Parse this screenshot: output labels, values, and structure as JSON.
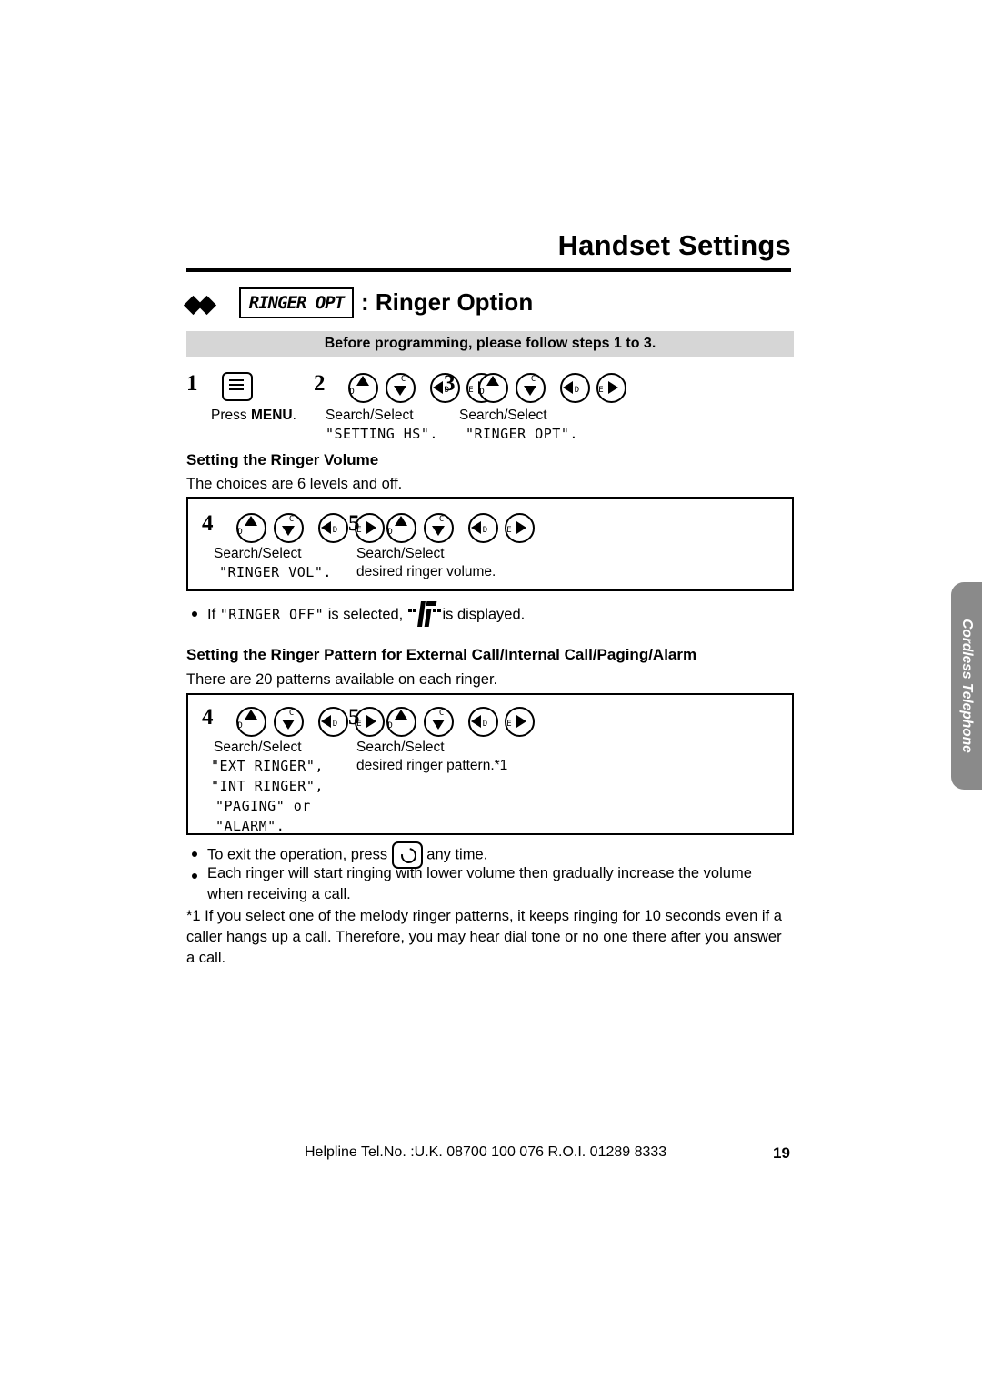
{
  "header": {
    "title": "Handset Settings"
  },
  "section": {
    "lcd_label": "RINGER OPT",
    "title": ": Ringer Option",
    "notice": "Before programming, please follow steps 1 to 3."
  },
  "steps_top": [
    {
      "num": "1",
      "caption": "Press ",
      "caption_bold": "MENU",
      "caption_end": ".",
      "lcd": ""
    },
    {
      "num": "2",
      "caption": "Search/Select",
      "lcd": "\"SETTING HS\"."
    },
    {
      "num": "3",
      "caption": "Search/Select",
      "lcd": "\"RINGER OPT\"."
    }
  ],
  "volume": {
    "heading": "Setting the Ringer Volume",
    "subtext": "The choices are 6 levels and off.",
    "steps": [
      {
        "num": "4",
        "caption": "Search/Select",
        "lcd": "\"RINGER VOL\"."
      },
      {
        "num": "5",
        "caption": "Search/Select",
        "lcd": "desired ringer volume."
      }
    ],
    "note_pre": "If ",
    "note_code": "\"RINGER OFF\"",
    "note_mid": " is selected, ",
    "note_end": " is displayed."
  },
  "pattern": {
    "heading": "Setting the Ringer Pattern for External Call/Internal Call/Paging/Alarm",
    "subtext": "There are 20 patterns available on each ringer.",
    "steps": [
      {
        "num": "4",
        "caption": "Search/Select",
        "lcd_lines": [
          "\"EXT RINGER\",",
          "\"INT RINGER\",",
          "\"PAGING\" or",
          "\"ALARM\"."
        ]
      },
      {
        "num": "5",
        "caption": "Search/Select",
        "lcd_lines": [
          "desired ringer pattern.*1"
        ]
      }
    ]
  },
  "notes": [
    {
      "pre": "To exit the operation, press ",
      "post": " any time."
    },
    {
      "text": "Each ringer will start ringing with lower volume then gradually increase the volume when receiving a call."
    }
  ],
  "footnote": "*1 If you select one of the melody ringer patterns, it keeps ringing for 10 seconds even if a caller hangs up a call. Therefore, you may hear dial tone or no one there after you answer a call.",
  "sidetab": {
    "label": "Cordless Telephone"
  },
  "footer": {
    "helpline": "Helpline Tel.No. :U.K. 08700 100 076  R.O.I. 01289 8333",
    "page": "19"
  },
  "keys": {
    "up": "▲",
    "down": "▼",
    "left": "◀",
    "right": "▶"
  }
}
